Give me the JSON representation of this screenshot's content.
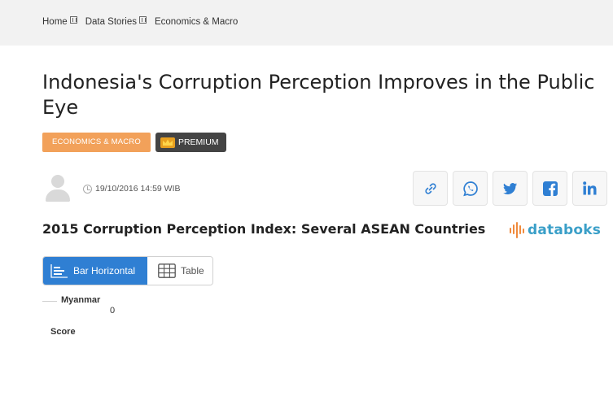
{
  "breadcrumb": {
    "items": [
      "Home",
      "Data Stories",
      "Economics & Macro"
    ]
  },
  "article": {
    "title": "Indonesia's Corruption Perception Improves in the Public Eye",
    "category_tag": "ECONOMICS & MACRO",
    "premium_label": "PREMIUM",
    "date": "19/10/2016 14:59 WIB"
  },
  "share_icons": [
    "link-icon",
    "whatsapp-icon",
    "twitter-icon",
    "facebook-icon",
    "linkedin-icon"
  ],
  "chart": {
    "title": "2015 Corruption Perception Index: Several ASEAN Countries",
    "logo_text": "databoks",
    "view_toggle": {
      "active": "Bar Horizontal",
      "inactive": "Table"
    }
  },
  "chart_data": {
    "type": "bar",
    "categories": [
      "Myanmar"
    ],
    "series": [
      {
        "name": "Score",
        "values": [
          0
        ]
      }
    ],
    "value_labels": [
      "0"
    ]
  },
  "colors": {
    "accent_blue": "#2f7fd3",
    "category_orange": "#f2a15a",
    "premium_dark": "#444444",
    "logo_blue": "#3a9fc8",
    "logo_orange": "#f08a3c"
  }
}
